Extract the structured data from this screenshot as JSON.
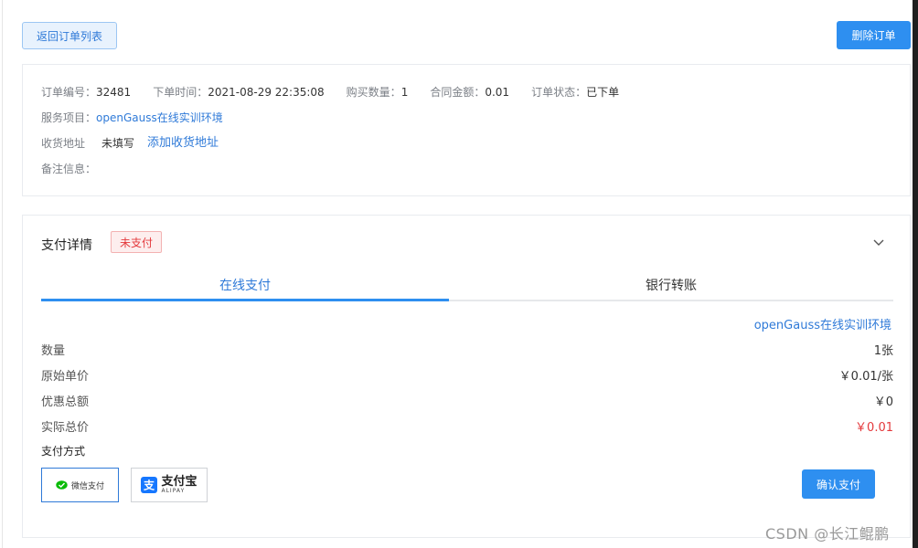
{
  "header": {
    "back_label": "返回订单列表",
    "delete_label": "删除订单"
  },
  "order": {
    "number_label": "订单编号：",
    "number": "32481",
    "time_label": "下单时间：",
    "time": "2021-08-29 22:35:08",
    "qty_label": "购买数量：",
    "qty": "1",
    "amount_label": "合同金额：",
    "amount": "0.01",
    "status_label": "订单状态：",
    "status": "已下单",
    "service_label": "服务项目：",
    "service": "openGauss在线实训环境",
    "address_label": "收货地址",
    "address_value": "未填写",
    "address_add": "添加收货地址",
    "remark_label": "备注信息："
  },
  "payment": {
    "title": "支付详情",
    "badge": "未支付",
    "tabs": [
      {
        "label": "在线支付",
        "active": true
      },
      {
        "label": "银行转账",
        "active": false
      }
    ],
    "product": "openGauss在线实训环境",
    "items": [
      {
        "key": "数量",
        "value": "1张"
      },
      {
        "key": "原始单价",
        "value": "￥0.01/张"
      },
      {
        "key": "优惠总额",
        "value": "￥0"
      },
      {
        "key": "实际总价",
        "value": "￥0.01"
      }
    ],
    "method_label": "支付方式",
    "wechat_label": "微信支付",
    "alipay_cn": "支付宝",
    "alipay_en": "ALIPAY",
    "confirm_label": "确认支付"
  },
  "watermark": "CSDN @长江鲲鹏",
  "colors": {
    "primary": "#2e8ff0",
    "link": "#2f7ad8",
    "danger": "#e4393c",
    "wechat": "#09bb07",
    "alipay": "#1677ff"
  }
}
